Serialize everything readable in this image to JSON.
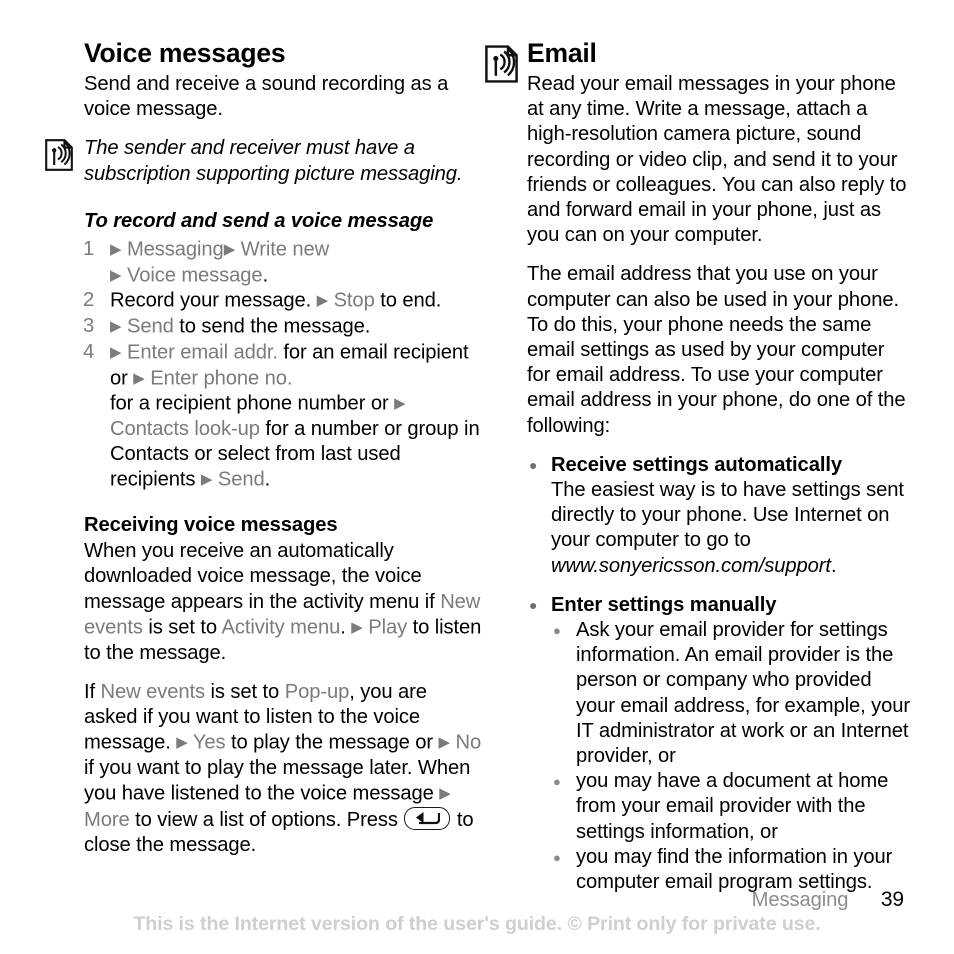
{
  "document": {
    "chapter": "Messaging",
    "page_number": "39",
    "disclaimer": "This is the Internet version of the user's guide. © Print only for private use."
  },
  "left_column": {
    "title": "Voice messages",
    "intro": "Send and receive a sound recording as a voice message.",
    "note": {
      "icon": "note-antenna-icon",
      "text": "The sender and receiver must have a subscription supporting picture messaging."
    },
    "task": {
      "heading": "To record and send a voice message",
      "steps": [
        {
          "num": "1",
          "parts": [
            {
              "type": "arrow"
            },
            {
              "type": "menu",
              "text": "Messaging"
            },
            {
              "type": "arrow"
            },
            {
              "type": "menu",
              "text": "Write new"
            },
            {
              "type": "break"
            },
            {
              "type": "arrow"
            },
            {
              "type": "menu",
              "text": "Voice message"
            },
            {
              "type": "plain",
              "text": "."
            }
          ]
        },
        {
          "num": "2",
          "parts": [
            {
              "type": "plain",
              "text": "Record your message. "
            },
            {
              "type": "arrow"
            },
            {
              "type": "menu",
              "text": "Stop"
            },
            {
              "type": "plain",
              "text": " to end."
            }
          ]
        },
        {
          "num": "3",
          "parts": [
            {
              "type": "arrow"
            },
            {
              "type": "menu",
              "text": "Send"
            },
            {
              "type": "plain",
              "text": " to send the message."
            }
          ]
        },
        {
          "num": "4",
          "parts": [
            {
              "type": "arrow"
            },
            {
              "type": "menu",
              "text": "Enter email addr."
            },
            {
              "type": "plain",
              "text": " for an email recipient or "
            },
            {
              "type": "arrow"
            },
            {
              "type": "menu",
              "text": "Enter phone no."
            },
            {
              "type": "break"
            },
            {
              "type": "plain",
              "text": "for a recipient phone number or "
            },
            {
              "type": "arrow"
            },
            {
              "type": "menu",
              "text": "Contacts look-up"
            },
            {
              "type": "plain",
              "text": " for a number or group in Contacts or select from last used recipients "
            },
            {
              "type": "arrow"
            },
            {
              "type": "menu",
              "text": "Send"
            },
            {
              "type": "plain",
              "text": "."
            }
          ]
        }
      ]
    },
    "receiving": {
      "heading": "Receiving voice messages",
      "para1": [
        {
          "type": "plain",
          "text": "When you receive an automatically downloaded voice message, the voice message appears in the activity menu if "
        },
        {
          "type": "menu",
          "text": "New events"
        },
        {
          "type": "plain",
          "text": " is set to "
        },
        {
          "type": "menu",
          "text": "Activity menu"
        },
        {
          "type": "plain",
          "text": ". "
        },
        {
          "type": "arrow"
        },
        {
          "type": "menu",
          "text": "Play"
        },
        {
          "type": "plain",
          "text": " to listen to the message."
        }
      ],
      "para2": [
        {
          "type": "plain",
          "text": "If "
        },
        {
          "type": "menu",
          "text": "New events"
        },
        {
          "type": "plain",
          "text": " is set to "
        },
        {
          "type": "menu",
          "text": "Pop-up"
        },
        {
          "type": "plain",
          "text": ", you are asked if you want to listen to the voice message. "
        },
        {
          "type": "arrow"
        },
        {
          "type": "menu",
          "text": "Yes"
        },
        {
          "type": "plain",
          "text": " to play the message or "
        },
        {
          "type": "arrow"
        },
        {
          "type": "menu",
          "text": "No"
        },
        {
          "type": "plain",
          "text": " if you want to play the message later. When you have listened to the voice message "
        },
        {
          "type": "arrow"
        },
        {
          "type": "menu",
          "text": "More"
        },
        {
          "type": "plain",
          "text": " to view a list of options. Press "
        },
        {
          "type": "backkey"
        },
        {
          "type": "plain",
          "text": " to close the message."
        }
      ]
    }
  },
  "right_column": {
    "title": "Email",
    "icon": "email-antenna-icon",
    "para1": "Read your email messages in your phone at any time. Write a message, attach a high-resolution camera picture, sound recording or video clip, and send it to your friends or colleagues. You can also reply to and forward email in your phone, just as you can on your computer.",
    "para2": "The email address that you use on your computer can also be used in your phone. To do this, your phone needs the same email settings as used by your computer for email address. To use your computer email address in your phone, do one of the following:",
    "bullets": [
      {
        "title": "Receive settings automatically",
        "body_parts": [
          {
            "type": "plain",
            "text": "The easiest way is to have settings sent directly to your phone. Use Internet on your computer to go to "
          },
          {
            "type": "italic",
            "text": "www.sonyericsson.com/support"
          },
          {
            "type": "plain",
            "text": "."
          }
        ]
      },
      {
        "title": "Enter settings manually",
        "sub_bullets": [
          "Ask your email provider for settings information. An email provider is the person or company who provided your email address, for example, your IT administrator at work or an Internet provider, or",
          "you may have a document at home from your email provider with the settings information, or",
          "you may find the information in your computer email program settings."
        ]
      }
    ]
  }
}
